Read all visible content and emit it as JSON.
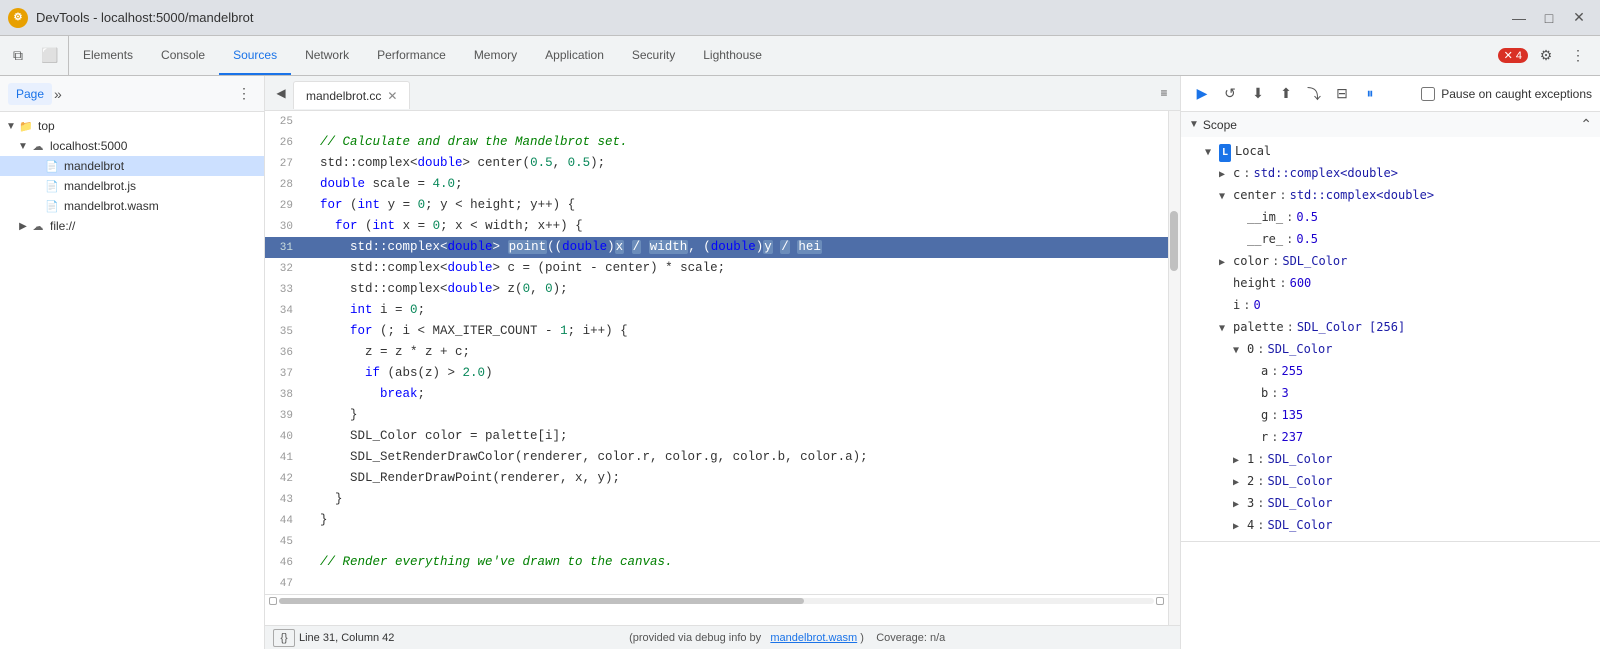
{
  "titlebar": {
    "icon": "⚙",
    "title": "DevTools - localhost:5000/mandelbrot",
    "min": "—",
    "max": "□",
    "close": "✕"
  },
  "tabs": {
    "items": [
      {
        "label": "Elements",
        "active": false
      },
      {
        "label": "Console",
        "active": false
      },
      {
        "label": "Sources",
        "active": true
      },
      {
        "label": "Network",
        "active": false
      },
      {
        "label": "Performance",
        "active": false
      },
      {
        "label": "Memory",
        "active": false
      },
      {
        "label": "Application",
        "active": false
      },
      {
        "label": "Security",
        "active": false
      },
      {
        "label": "Lighthouse",
        "active": false
      }
    ],
    "error_count": "4"
  },
  "sidebar": {
    "tab": "Page",
    "more_icon": "»",
    "three_dot": "⋮",
    "file_tree": [
      {
        "indent": 0,
        "arrow": "▼",
        "icon": "folder",
        "label": "top",
        "level": "top"
      },
      {
        "indent": 1,
        "arrow": "▼",
        "icon": "cloud",
        "label": "localhost:5000"
      },
      {
        "indent": 2,
        "arrow": "",
        "icon": "cc",
        "label": "mandelbrot",
        "selected": true
      },
      {
        "indent": 2,
        "arrow": "",
        "icon": "js",
        "label": "mandelbrot.js"
      },
      {
        "indent": 2,
        "arrow": "",
        "icon": "wasm",
        "label": "mandelbrot.wasm"
      },
      {
        "indent": 1,
        "arrow": "▶",
        "icon": "cloud",
        "label": "file://"
      }
    ]
  },
  "editor": {
    "filename": "mandelbrot.cc",
    "lines": [
      {
        "num": 25,
        "text": ""
      },
      {
        "num": 26,
        "text": "  // Calculate and draw the Mandelbrot set.",
        "comment": true
      },
      {
        "num": 27,
        "text": "  std::complex<double> center(0.5, 0.5);"
      },
      {
        "num": 28,
        "text": "  double scale = 4.0;"
      },
      {
        "num": 29,
        "text": "  for (int y = 0; y < height; y++) {"
      },
      {
        "num": 30,
        "text": "    for (int x = 0; x < width; x++) {"
      },
      {
        "num": 31,
        "text": "      std::complex<double> point((double)x / width, (double)y / hei",
        "highlighted": true
      },
      {
        "num": 32,
        "text": "      std::complex<double> c = (point - center) * scale;"
      },
      {
        "num": 33,
        "text": "      std::complex<double> z(0, 0);"
      },
      {
        "num": 34,
        "text": "      int i = 0;"
      },
      {
        "num": 35,
        "text": "      for (; i < MAX_ITER_COUNT - 1; i++) {"
      },
      {
        "num": 36,
        "text": "        z = z * z + c;"
      },
      {
        "num": 37,
        "text": "        if (abs(z) > 2.0)"
      },
      {
        "num": 38,
        "text": "          break;"
      },
      {
        "num": 39,
        "text": "      }"
      },
      {
        "num": 40,
        "text": "      SDL_Color color = palette[i];"
      },
      {
        "num": 41,
        "text": "      SDL_SetRenderDrawColor(renderer, color.r, color.g, color.b, color.a);"
      },
      {
        "num": 42,
        "text": "      SDL_RenderDrawPoint(renderer, x, y);"
      },
      {
        "num": 43,
        "text": "    }"
      },
      {
        "num": 44,
        "text": "  }"
      },
      {
        "num": 45,
        "text": ""
      },
      {
        "num": 46,
        "text": "  // Render everything we've drawn to the canvas.",
        "comment": true
      },
      {
        "num": 47,
        "text": ""
      }
    ]
  },
  "statusbar": {
    "line": "Line 31, Column 42",
    "debug_info": "(provided via debug info by",
    "debug_link": "mandelbrot.wasm",
    "coverage": "Coverage: n/a"
  },
  "debugpanel": {
    "pause_label": "Pause on caught exceptions",
    "scope_label": "Scope",
    "local_label": "Local",
    "scope_items": [
      {
        "indent": 1,
        "arrow": "▶",
        "key": "c",
        "colon": ":",
        "val": "std::complex<double>"
      },
      {
        "indent": 1,
        "arrow": "▼",
        "key": "center",
        "colon": ":",
        "val": "std::complex<double>"
      },
      {
        "indent": 2,
        "arrow": "",
        "key": "__im_",
        "colon": ":",
        "val": "0.5",
        "type": "num"
      },
      {
        "indent": 2,
        "arrow": "",
        "key": "__re_",
        "colon": ":",
        "val": "0.5",
        "type": "num"
      },
      {
        "indent": 1,
        "arrow": "▶",
        "key": "color",
        "colon": ":",
        "val": "SDL_Color"
      },
      {
        "indent": 1,
        "arrow": "",
        "key": "height",
        "colon": ":",
        "val": "600",
        "type": "num"
      },
      {
        "indent": 1,
        "arrow": "",
        "key": "i",
        "colon": ":",
        "val": "0",
        "type": "num"
      },
      {
        "indent": 1,
        "arrow": "▼",
        "key": "palette",
        "colon": ":",
        "val": "SDL_Color [256]"
      },
      {
        "indent": 2,
        "arrow": "▼",
        "key": "0",
        "colon": ":",
        "val": "SDL_Color"
      },
      {
        "indent": 3,
        "arrow": "",
        "key": "a",
        "colon": ":",
        "val": "255",
        "type": "num"
      },
      {
        "indent": 3,
        "arrow": "",
        "key": "b",
        "colon": ":",
        "val": "3",
        "type": "num"
      },
      {
        "indent": 3,
        "arrow": "",
        "key": "g",
        "colon": ":",
        "val": "135",
        "type": "num"
      },
      {
        "indent": 3,
        "arrow": "",
        "key": "r",
        "colon": ":",
        "val": "237",
        "type": "num"
      },
      {
        "indent": 2,
        "arrow": "▶",
        "key": "1",
        "colon": ":",
        "val": "SDL_Color"
      },
      {
        "indent": 2,
        "arrow": "▶",
        "key": "2",
        "colon": ":",
        "val": "SDL_Color"
      },
      {
        "indent": 2,
        "arrow": "▶",
        "key": "3",
        "colon": ":",
        "val": "SDL_Color"
      },
      {
        "indent": 2,
        "arrow": "▶",
        "key": "4",
        "colon": ":",
        "val": "SDL_Color"
      }
    ]
  }
}
